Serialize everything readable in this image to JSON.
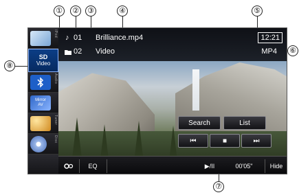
{
  "callouts": [
    "①",
    "②",
    "③",
    "④",
    "⑤",
    "⑥",
    "⑦",
    "⑧"
  ],
  "info": {
    "track_icon": "♪",
    "track_number": "01",
    "folder_number": "02",
    "file_name": "Brilliance.mp4",
    "folder_name": "Video",
    "clock": "12:21",
    "format": "MP4"
  },
  "sidebar": {
    "tabs": [
      {
        "label": "iPod",
        "icon": "ipod-thumb-icon"
      },
      {
        "label": "SD",
        "sub": "Video",
        "active": true
      },
      {
        "label": "Audio",
        "icon": "bluetooth-icon"
      },
      {
        "label": "Mirror AV",
        "icon": "mirror-av-icon"
      },
      {
        "label": "Tuner",
        "icon": "tuner-icon"
      },
      {
        "label": "Disc",
        "icon": "disc-icon"
      }
    ]
  },
  "controls": {
    "search": "Search",
    "list": "List",
    "prev": "⏮",
    "stop": "■",
    "next": "⏭"
  },
  "bottom": {
    "settings_icon": "settings-icon",
    "eq": "EQ",
    "play_pause": "▶/II",
    "elapsed": "00'05\"",
    "hide": "Hide"
  },
  "colors": {
    "active_tab": "#0c3e86",
    "screen_bg": "#0d0d10"
  }
}
